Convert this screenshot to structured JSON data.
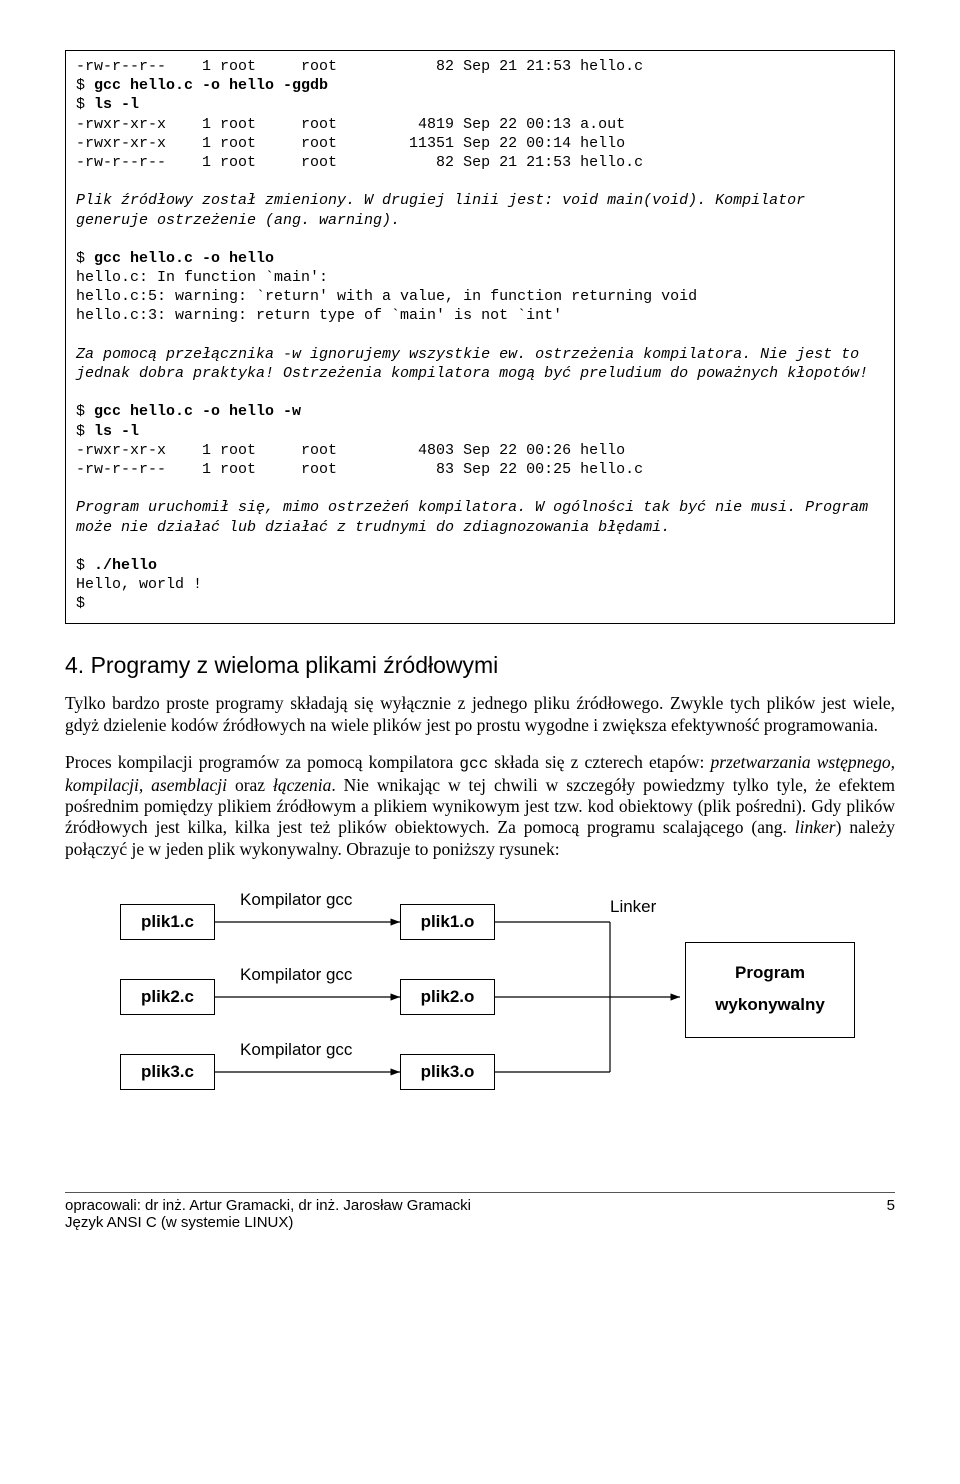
{
  "term": {
    "l01": "-rw-r--r--    1 root     root           82 Sep 21 21:53 hello.c",
    "l02a": "$ ",
    "l02b": "gcc hello.c -o hello -ggdb",
    "l03a": "$ ",
    "l03b": "ls -l",
    "l04": "-rwxr-xr-x    1 root     root         4819 Sep 22 00:13 a.out",
    "l05": "-rwxr-xr-x    1 root     root        11351 Sep 22 00:14 hello",
    "l06": "-rw-r--r--    1 root     root           82 Sep 21 21:53 hello.c",
    "l07": "",
    "l08": "Plik źródłowy został zmieniony. W drugiej linii jest: void main(void). Kompilator generuje ostrzeżenie (ang. warning).",
    "l09": "",
    "l10a": "$ ",
    "l10b": "gcc hello.c -o hello",
    "l11": "hello.c: In function `main':",
    "l12": "hello.c:5: warning: `return' with a value, in function returning void",
    "l13": "hello.c:3: warning: return type of `main' is not `int'",
    "l14": "",
    "l15": "Za pomocą przełącznika -w ignorujemy wszystkie ew. ostrzeżenia kompilatora. Nie jest to jednak dobra praktyka! Ostrzeżenia kompilatora mogą być preludium do poważnych kłopotów!",
    "l16": "",
    "l17a": "$ ",
    "l17b": "gcc hello.c -o hello -w",
    "l18a": "$ ",
    "l18b": "ls -l",
    "l19": "-rwxr-xr-x    1 root     root         4803 Sep 22 00:26 hello",
    "l20": "-rw-r--r--    1 root     root           83 Sep 22 00:25 hello.c",
    "l21": "",
    "l22": "Program uruchomił się, mimo ostrzeżeń kompilatora. W ogólności tak być nie musi. Program może nie działać lub działać z trudnymi do zdiagnozowania błędami.",
    "l23": "",
    "l24a": "$ ",
    "l24b": "./hello",
    "l25": "Hello, world !",
    "l26": "$"
  },
  "section_title": "4. Programy z wieloma plikami źródłowymi",
  "para1_a": "Tylko bardzo proste programy składają się wyłącznie z jednego pliku źródłowego. Zwykle tych plików jest wiele, gdyż dzielenie kodów źródłowych na wiele plików jest po prostu wygodne i zwiększa efektywność programowania.",
  "para2_a": "Proces kompilacji programów za pomocą kompilatora ",
  "para2_gcc": "gcc",
  "para2_b": " składa się z czterech etapów: ",
  "para2_ital": "przetwarzania wstępnego, kompilacji, asemblacji",
  "para2_c": " oraz ",
  "para2_ital2": "łączenia",
  "para2_d": ". Nie wnikając w tej chwili w szczegóły powiedzmy tylko tyle, że efektem pośrednim pomiędzy plikiem źródłowym a plikiem wynikowym jest tzw. kod obiektowy (plik pośredni). Gdy plików źródłowych jest kilka, kilka jest też plików obiektowych. Za pomocą programu scalającego (ang. ",
  "para2_ital3": "linker",
  "para2_e": ") należy połączyć je w jeden plik wykonywalny. Obrazuje to poniższy rysunek:",
  "diagram": {
    "c1": "plik1.c",
    "c2": "plik2.c",
    "c3": "plik3.c",
    "k": "Kompilator gcc",
    "o1": "plik1.o",
    "o2": "plik2.o",
    "o3": "plik3.o",
    "linker": "Linker",
    "prog1": "Program",
    "prog2": "wykonywalny"
  },
  "footer": {
    "line1": "opracowali: dr inż. Artur Gramacki, dr inż. Jarosław Gramacki",
    "line2": "Język ANSI C (w systemie LINUX)",
    "pagenum": "5"
  }
}
